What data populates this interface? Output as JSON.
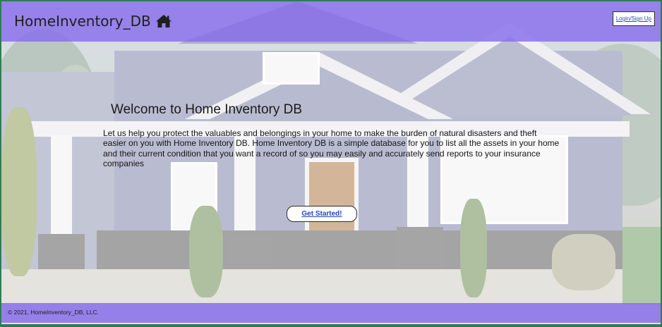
{
  "header": {
    "brand_name": "HomeInventory_DB",
    "brand_icon": "home-icon",
    "login_label": "Login/Sign Up"
  },
  "hero": {
    "title": "Welcome to Home Inventory DB",
    "description": "Let us help you protect the valuables and belongings in your home to make the burden of natural disasters and theft easier on you with Home Inventory DB. Home Inventory DB is a simple database for you to list all the assets in your home and their current condition that you want a record of so you may easily and accurately send reports to your insurance companies",
    "cta_label": "Get Started!"
  },
  "footer": {
    "copyright": "© 2021, HomeInventory_DB, LLC."
  },
  "colors": {
    "header_bg": "#876eeb",
    "footer_bg": "#876eeb",
    "link": "#2148b8",
    "frame": "#2f7d52"
  }
}
